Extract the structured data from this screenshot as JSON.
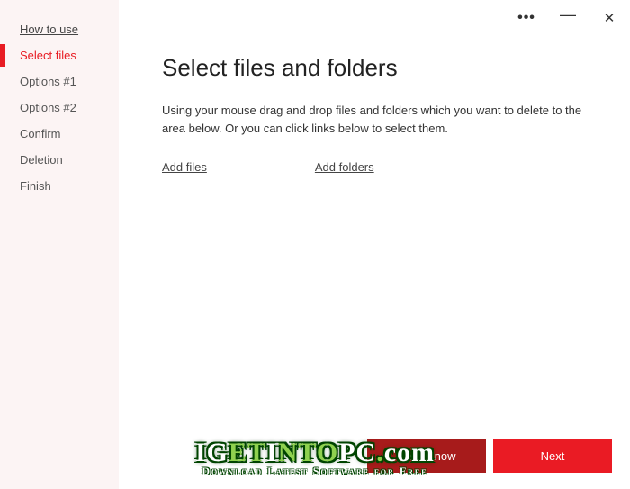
{
  "sidebar": {
    "items": [
      {
        "label": "How to use",
        "link": true,
        "active": false
      },
      {
        "label": "Select files",
        "link": false,
        "active": true
      },
      {
        "label": "Options #1",
        "link": false,
        "active": false
      },
      {
        "label": "Options #2",
        "link": false,
        "active": false
      },
      {
        "label": "Confirm",
        "link": false,
        "active": false
      },
      {
        "label": "Deletion",
        "link": false,
        "active": false
      },
      {
        "label": "Finish",
        "link": false,
        "active": false
      }
    ]
  },
  "titlebar": {
    "more": "•••",
    "minimize": "—",
    "close": "✕"
  },
  "page": {
    "title": "Select files and folders",
    "instructions": "Using your mouse drag and drop files and folders which you want to delete to the area below. Or you can click links below to select them.",
    "add_files": "Add files",
    "add_folders": "Add folders"
  },
  "footer": {
    "delete_now": "Delete now",
    "next": "Next"
  },
  "watermark": {
    "line1_pre": "IG",
    "line1_mid_green": "ET",
    "line1_mid": "I",
    "line1_mid2_green": "NTO",
    "line1_post": "PC",
    "line1_dot_green": ".",
    "line1_com": "com",
    "line2": "Download Latest Software for Free"
  }
}
